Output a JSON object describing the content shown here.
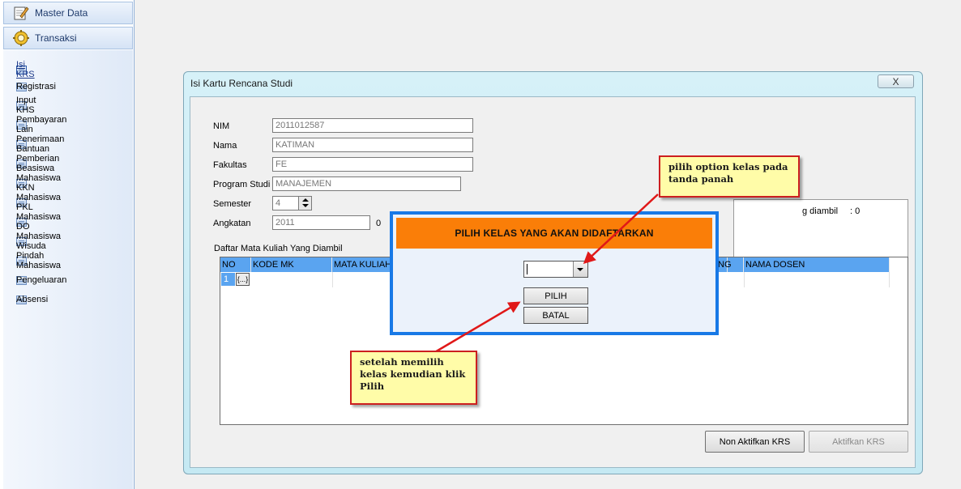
{
  "sidebar": {
    "headers": [
      {
        "label": "Master Data",
        "icon": "notepad-pencil-icon"
      },
      {
        "label": "Transaksi",
        "icon": "gear-icon"
      }
    ],
    "items": [
      {
        "label": "Isi KRS",
        "active": true
      },
      {
        "label": "Registrasi"
      },
      {
        "label": "Input KHS"
      },
      {
        "label": "Pembayaran Lain"
      },
      {
        "label": "Penerimaan Bantuan"
      },
      {
        "label": "Pemberian Beasiswa"
      },
      {
        "label": "Mahasiswa KKN"
      },
      {
        "label": "Mahasiswa PKL"
      },
      {
        "label": "Mahasiswa DO"
      },
      {
        "label": "Mahasiswa Wisuda"
      },
      {
        "label": "Pindah Mahasiswa"
      },
      {
        "label": "Pengeluaran"
      },
      {
        "label": "Absensi"
      }
    ]
  },
  "window": {
    "title": "Isi Kartu Rencana Studi",
    "close_label": "X"
  },
  "form": {
    "nim_label": "NIM",
    "nim_value": "2011012587",
    "nama_label": "Nama",
    "nama_value": "KATIMAN",
    "fakultas_label": "Fakultas",
    "fakultas_value": "FE",
    "prodi_label": "Program Studi",
    "prodi_value": "MANAJEMEN",
    "semester_label": "Semester",
    "semester_value": "4",
    "angkatan_label": "Angkatan",
    "angkatan_value": "2011",
    "angkatan_extra": "0"
  },
  "info": {
    "label": "g diambil",
    "value": ": 0"
  },
  "grid": {
    "title": "Daftar Mata Kuliah Yang Diambil",
    "columns": [
      "NO",
      "KODE MK",
      "MATA KULIAH",
      "NG",
      "NAMA DOSEN"
    ],
    "rows": [
      {
        "no": "1",
        "button": "{...}"
      }
    ]
  },
  "buttons": {
    "non_aktifkan": "Non Aktifkan KRS",
    "aktifkan": "Aktifkan KRS"
  },
  "dialog": {
    "title": "PILIH KELAS YANG AKAN DIDAFTARKAN",
    "combo_value": "",
    "pilih": "PILIH",
    "batal": "BATAL"
  },
  "callouts": {
    "top": "pilih option kelas pada\ntanda panah",
    "bottom": "setelah memilih\nkelas kemudian klik\nPilih"
  },
  "colors": {
    "dialog_header": "#fa7e08",
    "dialog_border": "#1879e6",
    "grid_header": "#5aa4f0",
    "callout_bg": "#fffca8",
    "callout_border": "#cc1f1f"
  }
}
